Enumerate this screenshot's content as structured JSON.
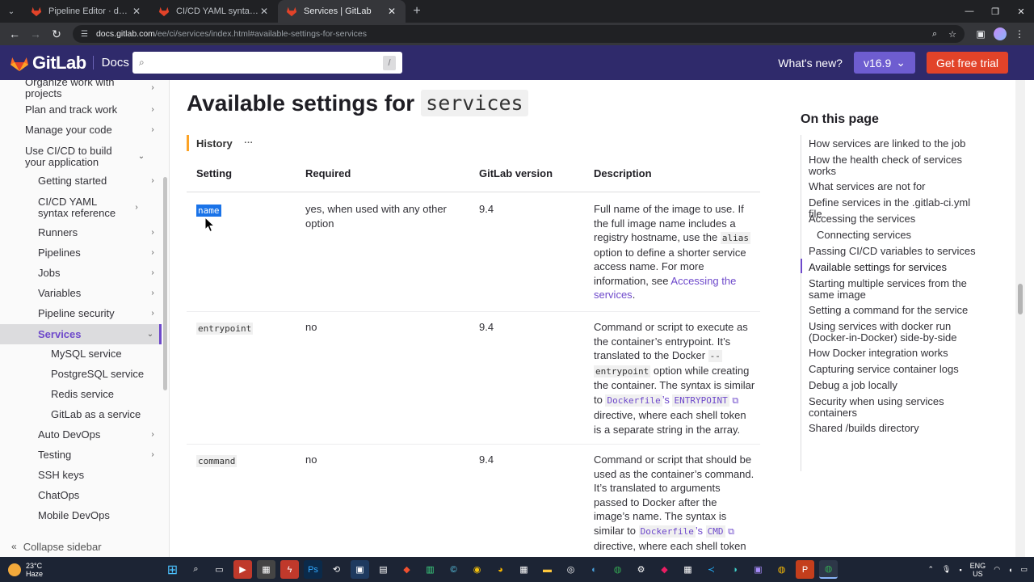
{
  "browser": {
    "tabs": [
      {
        "title": "Pipeline Editor · demos-group /",
        "color": "#e24329"
      },
      {
        "title": "CI/CD YAML syntax reference | G",
        "color": "#e24329"
      },
      {
        "title": "Services | GitLab",
        "color": "#e24329",
        "active": true
      }
    ],
    "url_host": "docs.gitlab.com",
    "url_path": "/ee/ci/services/index.html#available-settings-for-services"
  },
  "header": {
    "wordmark": "GitLab",
    "docs": "Docs",
    "search_placeholder": "",
    "search_shortcut": "/",
    "whats_new": "What's new?",
    "version": "v16.9",
    "trial": "Get free trial"
  },
  "sidebar": {
    "items": [
      {
        "label": "Organize work with projects",
        "chevron": "›"
      },
      {
        "label": "Plan and track work",
        "chevron": "›"
      },
      {
        "label": "Manage your code",
        "chevron": "›"
      },
      {
        "label": "Use CI/CD to build your application",
        "chevron": "⌄"
      },
      {
        "label": "Getting started",
        "chevron": "›"
      },
      {
        "label": "CI/CD YAML syntax reference",
        "chevron": "›"
      },
      {
        "label": "Runners",
        "chevron": "›"
      },
      {
        "label": "Pipelines",
        "chevron": "›"
      },
      {
        "label": "Jobs",
        "chevron": "›"
      },
      {
        "label": "Variables",
        "chevron": "›"
      },
      {
        "label": "Pipeline security",
        "chevron": "›"
      },
      {
        "label": "Services",
        "chevron": "⌄"
      },
      {
        "label": "MySQL service",
        "chevron": ""
      },
      {
        "label": "PostgreSQL service",
        "chevron": ""
      },
      {
        "label": "Redis service",
        "chevron": ""
      },
      {
        "label": "GitLab as a service",
        "chevron": ""
      },
      {
        "label": "Auto DevOps",
        "chevron": "›"
      },
      {
        "label": "Testing",
        "chevron": "›"
      },
      {
        "label": "SSH keys",
        "chevron": ""
      },
      {
        "label": "ChatOps",
        "chevron": ""
      },
      {
        "label": "Mobile DevOps",
        "chevron": ""
      }
    ],
    "collapse": "Collapse sidebar"
  },
  "content": {
    "title": "Available settings for",
    "title_code": "services",
    "history": "History",
    "history_dots": "···",
    "columns": [
      "Setting",
      "Required",
      "GitLab version",
      "Description"
    ],
    "rows": [
      {
        "setting": "name",
        "required": "yes, when used with any other option",
        "version": "9.4",
        "desc_lines": [
          "Full name of the image to use. If",
          "the full image name includes a",
          "registry hostname, use the"
        ],
        "desc_code1": "alias",
        "desc_lines2": [
          "option to define a shorter service",
          "access name. For more",
          "information, see"
        ],
        "desc_link": "Accessing the services",
        "desc_link_a": "Accessing the",
        "desc_link_b": "services",
        "desc_end": "."
      },
      {
        "setting": "entrypoint",
        "required": "no",
        "version": "9.4",
        "l1": "Command or script to execute as",
        "l2": "the container’s entrypoint. It’s",
        "l3": "translated to the Docker",
        "code_a": "--",
        "code_b": "entrypoint",
        "l4": "option while creating",
        "l5": "the container. The syntax is similar",
        "l6_pre": "to",
        "l6_code1": "Dockerfile",
        "l6_mid": "’s",
        "l6_code2": "ENTRYPOINT",
        "l7": "directive, where each shell token",
        "l8": "is a separate string in the array."
      },
      {
        "setting": "command",
        "required": "no",
        "version": "9.4",
        "l1": "Command or script that should be",
        "l2": "used as the container’s command.",
        "l3": "It’s translated to arguments",
        "l4": "passed to Docker after the",
        "l5": "image’s name. The syntax is",
        "l6_pre": "similar to",
        "l6_code1": "Dockerfile",
        "l6_mid": "’s",
        "l6_code2": "CMD",
        "l7": "directive, where each shell token"
      }
    ]
  },
  "on_this_page": {
    "title": "On this page",
    "items": [
      "How services are linked to the job",
      "How the health check of services works",
      "What services are not for",
      "Define services in the .gitlab-ci.yml file",
      "Accessing the services",
      "Connecting services",
      "Passing CI/CD variables to services",
      "Available settings for services",
      "Starting multiple services from the same image",
      "Setting a command for the service",
      "Using services with docker run (Docker-in-Docker) side-by-side",
      "How Docker integration works",
      "Capturing service container logs",
      "Debug a job locally",
      "Security when using services containers",
      "Shared /builds directory"
    ]
  },
  "taskbar": {
    "temp": "23°C",
    "weather": "Haze",
    "lang1": "ENG",
    "lang2": "US"
  }
}
